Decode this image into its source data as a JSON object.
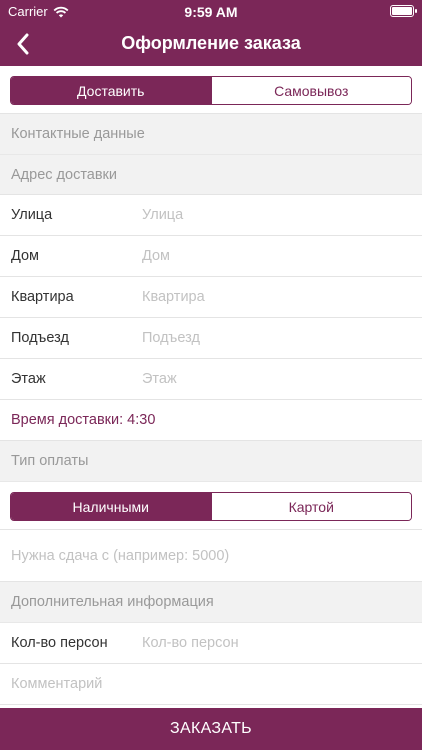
{
  "status_bar": {
    "carrier": "Carrier",
    "time": "9:59 AM"
  },
  "nav": {
    "title": "Оформление заказа"
  },
  "delivery_mode": {
    "options": [
      "Доставить",
      "Самовывоз"
    ],
    "selected": "Доставить"
  },
  "contact": {
    "header": "Контактные данные",
    "address_header": "Адрес доставки",
    "fields": [
      {
        "label": "Улица",
        "placeholder": "Улица",
        "value": ""
      },
      {
        "label": "Дом",
        "placeholder": "Дом",
        "value": ""
      },
      {
        "label": "Квартира",
        "placeholder": "Квартира",
        "value": ""
      },
      {
        "label": "Подъезд",
        "placeholder": "Подъезд",
        "value": ""
      },
      {
        "label": "Этаж",
        "placeholder": "Этаж",
        "value": ""
      }
    ],
    "delivery_time": "Время доставки: 4:30"
  },
  "payment": {
    "header": "Тип оплаты",
    "options": [
      "Наличными",
      "Картой"
    ],
    "selected": "Наличными",
    "change_placeholder": "Нужна сдача с (например: 5000)"
  },
  "extra": {
    "header": "Дополнительная информация",
    "persons_label": "Кол-во персон",
    "persons_placeholder": "Кол-во персон",
    "comment_placeholder": "Комментарий"
  },
  "order_button": "ЗАКАЗАТЬ",
  "colors": {
    "accent": "#7b2758",
    "section_bg": "#f2f2f2",
    "placeholder": "#c2c2c2"
  }
}
